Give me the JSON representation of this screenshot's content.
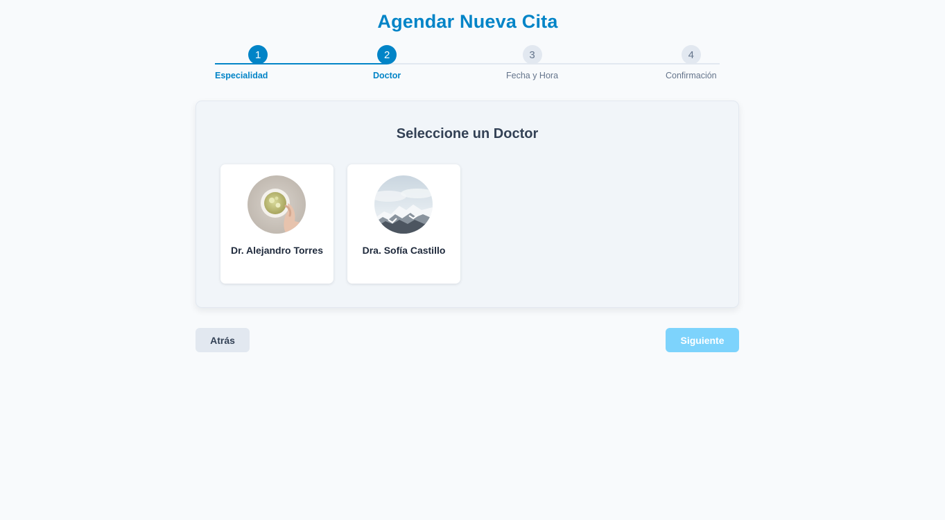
{
  "page": {
    "title": "Agendar Nueva Cita"
  },
  "stepper": {
    "current_step": 2,
    "steps": [
      {
        "number": "1",
        "label": "Especialidad",
        "state": "active"
      },
      {
        "number": "2",
        "label": "Doctor",
        "state": "active"
      },
      {
        "number": "3",
        "label": "Fecha y Hora",
        "state": "inactive"
      },
      {
        "number": "4",
        "label": "Confirmación",
        "state": "inactive"
      }
    ]
  },
  "doctor_selection": {
    "title": "Seleccione un Doctor",
    "doctors": [
      {
        "name": "Dr. Alejandro Torres",
        "avatar_icon": "tea-cup-photo"
      },
      {
        "name": "Dra. Sofía Castillo",
        "avatar_icon": "snowy-mountain-photo"
      }
    ]
  },
  "actions": {
    "back_label": "Atrás",
    "next_label": "Siguiente",
    "next_enabled": false
  },
  "colors": {
    "primary": "#0284c7",
    "primary_disabled": "#7dd3fc",
    "inactive": "#e2e8f0",
    "text_dark": "#334155"
  }
}
